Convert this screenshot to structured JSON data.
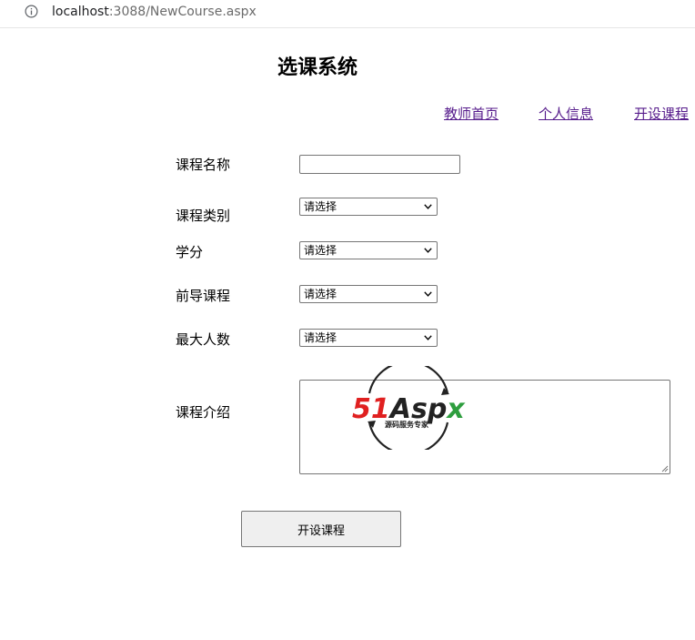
{
  "browser": {
    "url_host": "localhost",
    "url_rest": ":3088/NewCourse.aspx"
  },
  "page": {
    "title": "选课系统"
  },
  "nav": {
    "home": "教师首页",
    "profile": "个人信息",
    "open_course": "开设课程"
  },
  "form": {
    "course_name_label": "课程名称",
    "course_name_value": "",
    "category_label": "课程类别",
    "category_value": "请选择",
    "credit_label": "学分",
    "credit_value": "请选择",
    "prereq_label": "前导课程",
    "prereq_value": "请选择",
    "max_label": "最大人数",
    "max_value": "请选择",
    "intro_label": "课程介绍",
    "submit_label": "开设课程"
  },
  "watermark": {
    "brand_red": "51",
    "brand_black": "Asp",
    "brand_green": "x",
    "tagline": "源码服务专家"
  },
  "colors": {
    "link": "#551a8b",
    "watermark_red": "#e02020",
    "watermark_green": "#2e9e3e"
  }
}
